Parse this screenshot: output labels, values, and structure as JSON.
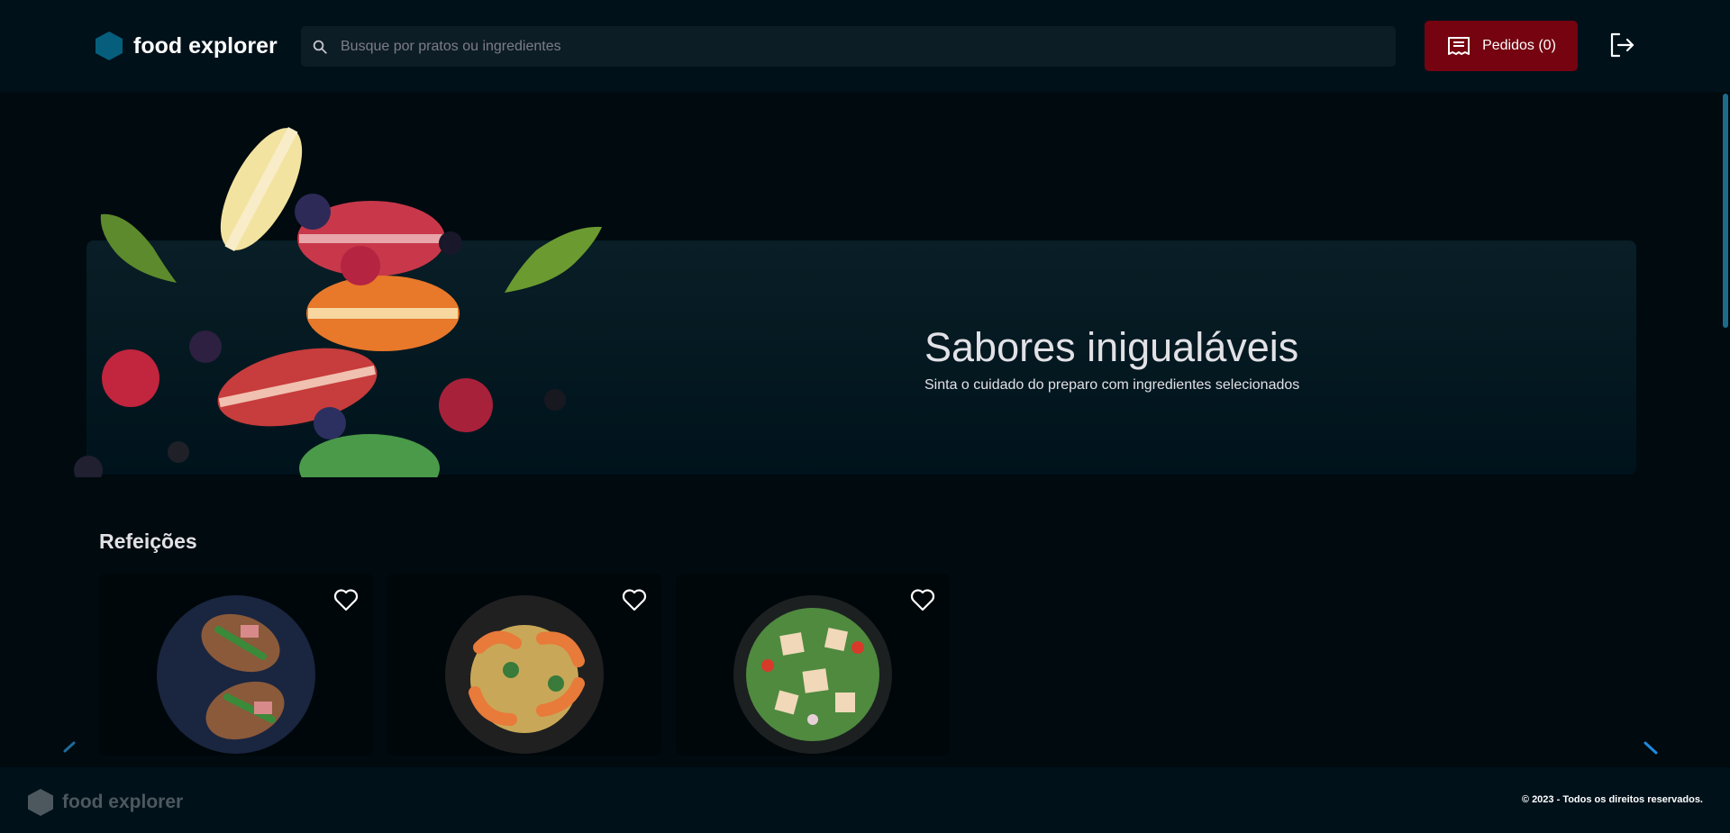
{
  "header": {
    "brand": "food explorer",
    "search_placeholder": "Busque por pratos ou ingredientes",
    "orders_label": "Pedidos (0)",
    "icons": {
      "logo": "hexagon-logo-icon",
      "search": "search-icon",
      "orders": "receipt-icon",
      "logout": "sign-out-icon"
    }
  },
  "colors": {
    "background": "#000a0f",
    "header": "#00111a",
    "accent_red": "#750310",
    "brand_blue": "#065e7c",
    "card": "#00070a"
  },
  "banner": {
    "title": "Sabores inigualáveis",
    "subtitle": "Sinta o cuidado do preparo com ingredientes selecionados"
  },
  "sections": [
    {
      "title": "Refeições",
      "cards": [
        {
          "image": "bruschetta-plate",
          "favorite_icon": "heart-outline-icon"
        },
        {
          "image": "shrimp-pasta-plate",
          "favorite_icon": "heart-outline-icon"
        },
        {
          "image": "salad-plate",
          "favorite_icon": "heart-outline-icon"
        }
      ],
      "nav": {
        "prev": "chevron-left-icon",
        "next": "chevron-right-icon"
      }
    }
  ],
  "footer": {
    "brand": "food explorer",
    "copyright": "© 2023 - Todos os direitos reservados."
  }
}
